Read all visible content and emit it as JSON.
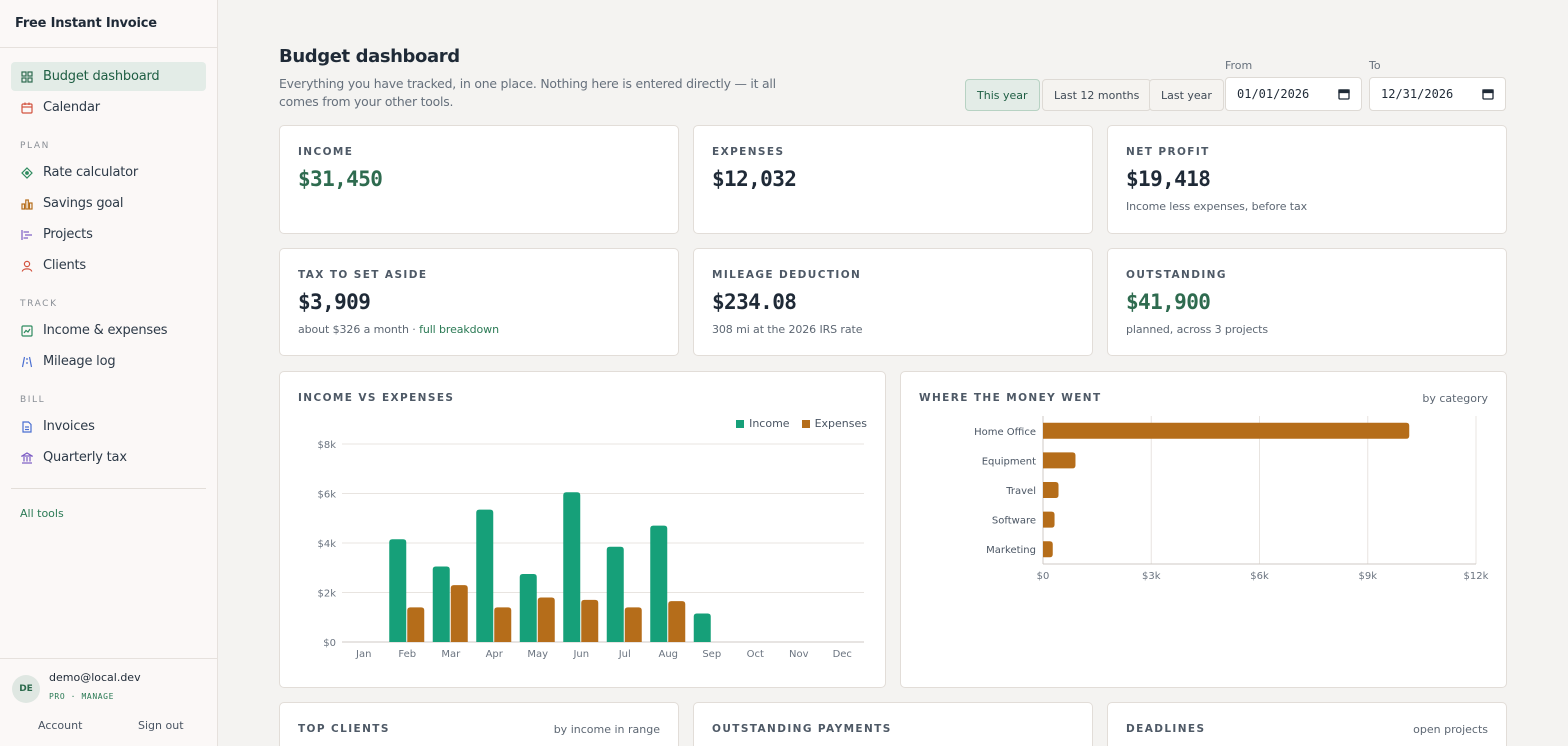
{
  "app": {
    "brand": "Free Instant Invoice"
  },
  "sidebar": {
    "items": [
      {
        "label": "Budget dashboard",
        "icon": "grid-icon"
      },
      {
        "label": "Calendar",
        "icon": "calendar-icon"
      }
    ],
    "plan_title": "PLAN",
    "plan_items": [
      {
        "label": "Rate calculator",
        "icon": "diamond-icon"
      },
      {
        "label": "Savings goal",
        "icon": "bar-chart-icon"
      },
      {
        "label": "Projects",
        "icon": "gantt-icon"
      },
      {
        "label": "Clients",
        "icon": "person-icon"
      }
    ],
    "track_title": "TRACK",
    "track_items": [
      {
        "label": "Income & expenses",
        "icon": "chart-box-icon"
      },
      {
        "label": "Mileage log",
        "icon": "road-icon"
      }
    ],
    "bill_title": "BILL",
    "bill_items": [
      {
        "label": "Invoices",
        "icon": "document-icon"
      },
      {
        "label": "Quarterly tax",
        "icon": "bank-icon"
      }
    ],
    "all_tools": "All tools",
    "user": {
      "initials": "DE",
      "email": "demo@local.dev",
      "plan": "PRO · MANAGE",
      "account": "Account",
      "sign_out": "Sign out"
    }
  },
  "header": {
    "title": "Budget dashboard",
    "subtitle": "Everything you have tracked, in one place. Nothing here is entered directly — it all comes from your other tools.",
    "ranges": [
      "This year",
      "Last 12 months",
      "Last year"
    ],
    "active_range": "This year",
    "from_label": "From",
    "from_value": "01/01/2026",
    "to_label": "To",
    "to_value": "12/31/2026"
  },
  "stats": {
    "income": {
      "label": "INCOME",
      "value": "$31,450"
    },
    "expenses": {
      "label": "EXPENSES",
      "value": "$12,032"
    },
    "net_profit": {
      "label": "NET PROFIT",
      "value": "$19,418",
      "note": "Income less expenses, before tax"
    },
    "tax": {
      "label": "TAX TO SET ASIDE",
      "value": "$3,909",
      "note": "about $326 a month · ",
      "link": "full breakdown"
    },
    "mileage": {
      "label": "MILEAGE DEDUCTION",
      "value": "$234.08",
      "note": "308 mi at the 2026 IRS rate"
    },
    "outstanding": {
      "label": "OUTSTANDING",
      "value": "$41,900",
      "note": "planned, across 3 projects"
    }
  },
  "colors": {
    "income": "#16a079",
    "expenses": "#b56d1a",
    "accent_green": "#2e6b4f"
  },
  "panels": {
    "income_vs_expenses": {
      "label": "INCOME VS EXPENSES",
      "legend_income": "Income",
      "legend_expenses": "Expenses"
    },
    "where_money_went": {
      "label": "WHERE THE MONEY WENT",
      "aside": "by category"
    },
    "top_clients": {
      "label": "TOP CLIENTS",
      "aside": "by income in range"
    },
    "outstanding_payments": {
      "label": "OUTSTANDING PAYMENTS"
    },
    "deadlines": {
      "label": "DEADLINES",
      "aside": "open projects"
    }
  },
  "chart_data": [
    {
      "type": "bar",
      "title": "INCOME VS EXPENSES",
      "categories": [
        "Jan",
        "Feb",
        "Mar",
        "Apr",
        "May",
        "Jun",
        "Jul",
        "Aug",
        "Sep",
        "Oct",
        "Nov",
        "Dec"
      ],
      "series": [
        {
          "name": "Income",
          "values": [
            0,
            4150,
            3050,
            5350,
            2750,
            6050,
            3850,
            4700,
            1150,
            0,
            0,
            0
          ]
        },
        {
          "name": "Expenses",
          "values": [
            0,
            1400,
            2300,
            1400,
            1800,
            1700,
            1400,
            1650,
            0,
            0,
            0,
            0
          ]
        }
      ],
      "yticks": [
        "$0",
        "$2k",
        "$4k",
        "$6k",
        "$8k"
      ],
      "ylim": [
        0,
        8000
      ],
      "grid": true,
      "legend": "top-right"
    },
    {
      "type": "bar",
      "orientation": "horizontal",
      "title": "WHERE THE MONEY WENT",
      "categories": [
        "Home Office",
        "Equipment",
        "Travel",
        "Software",
        "Marketing"
      ],
      "values": [
        10150,
        900,
        430,
        320,
        270
      ],
      "xticks": [
        "$0",
        "$3k",
        "$6k",
        "$9k",
        "$12k"
      ],
      "xlim": [
        0,
        12000
      ],
      "grid": true
    }
  ]
}
